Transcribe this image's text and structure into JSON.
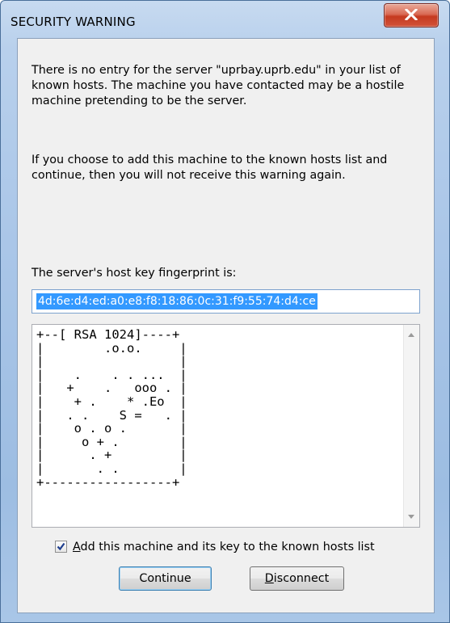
{
  "window": {
    "title": "SECURITY WARNING",
    "close_icon": "close-icon"
  },
  "message": {
    "paragraph1": "There is no entry for the server \"uprbay.uprb.edu\" in your list of known hosts. The machine you have contacted may be a hostile machine pretending to be the server.",
    "paragraph2": "If you choose to add this machine to the known hosts list and continue, then you will not receive this warning again."
  },
  "fingerprint": {
    "label": "The server's host key fingerprint is:",
    "value": "4d:6e:d4:ed:a0:e8:f8:18:86:0c:31:f9:55:74:d4:ce"
  },
  "randomart": {
    "text": "+--[ RSA 1024]----+\n|        .o.o.     |\n|                  |\n|    .    . . ...  |\n|   +    .   ooo . |\n|    + .    * .Eo  |\n|   . .    S =   . |\n|    o . o .       |\n|     o + .        |\n|      . +         |\n|       . .        |\n+-----------------+"
  },
  "checkbox": {
    "checked": true,
    "label_accel": "A",
    "label_rest": "dd this machine and its key to the known hosts list"
  },
  "buttons": {
    "continue": "Continue",
    "disconnect_accel": "D",
    "disconnect_rest": "isconnect"
  }
}
